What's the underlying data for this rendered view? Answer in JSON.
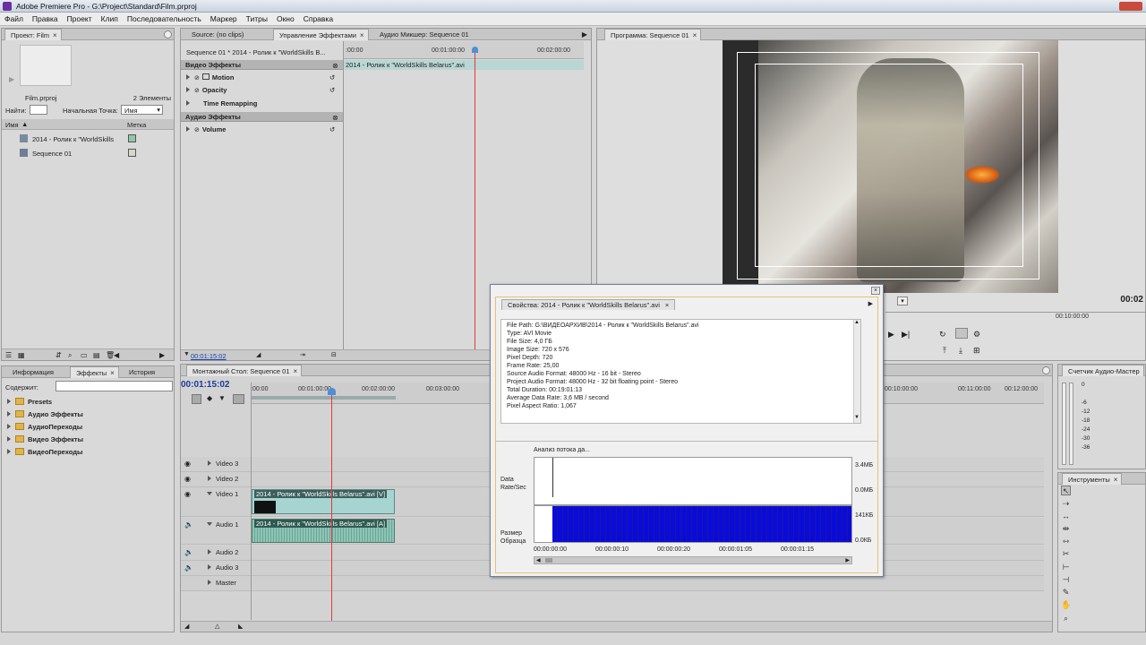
{
  "window": {
    "title": "Adobe Premiere Pro - G:\\Project\\Standard\\Film.prproj"
  },
  "menu": [
    "Файл",
    "Правка",
    "Проект",
    "Клип",
    "Последовательность",
    "Маркер",
    "Титры",
    "Окно",
    "Справка"
  ],
  "project_panel": {
    "tab": "Проект: Film",
    "file": "Film.prproj",
    "count": "2 Элементы",
    "find_label": "Найти:",
    "entry_label": "Начальная Точка:",
    "entry_value": "Имя",
    "col_name": "Имя",
    "col_label": "Метка",
    "items": [
      "2014 - Ролик к \"WorldSkills",
      "Sequence 01"
    ],
    "label_colors": [
      "#8fc7a4",
      "#d8d8c8"
    ]
  },
  "effect_controls": {
    "tabs": [
      "Source: (no clips)",
      "Управление Эффектами",
      "Аудио Микшер: Sequence 01"
    ],
    "sequence_label": "Sequence 01 * 2014 - Ролик к \"WorldSkills B...",
    "time_start": ":00:00",
    "time_mid": "00:01:00:00",
    "time_end": "00:02:00:00",
    "clip_name": "2014 - Ролик к \"WorldSkills Belarus\".avi",
    "video_header": "Видео Эффекты",
    "effects": [
      "Motion",
      "Opacity",
      "Time Remapping"
    ],
    "audio_header": "Аудио Эффекты",
    "audio_effects": [
      "Volume"
    ],
    "current_time": "00:01:15:02"
  },
  "program_monitor": {
    "tab": "Программа: Sequence 01",
    "time_right": "00:02",
    "ruler_time": "00:10:00:00"
  },
  "effects_panel": {
    "tabs": [
      "Информация",
      "Эффекты",
      "История"
    ],
    "search_label": "Содержит:",
    "folders": [
      "Presets",
      "Аудио Эффекты",
      "АудиоПереходы",
      "Видео Эффекты",
      "ВидеоПереходы"
    ]
  },
  "timeline": {
    "tab": "Монтажный Стол: Sequence 01",
    "timecode": "00:01:15:02",
    "ruler": [
      ":00:00",
      "00:01:00:00",
      "00:02:00:00",
      "00:03:00:00"
    ],
    "ruler_right": [
      "00:10:00:00",
      "00:11:00:00",
      "00:12:00:00"
    ],
    "tracks": [
      "Video 3",
      "Video 2",
      "Video 1",
      "Audio 1",
      "Audio 2",
      "Audio 3",
      "Master"
    ],
    "video_clip": "2014 - Ролик к \"WorldSkills Belarus\".avi [V]",
    "audio_clip": "2014 - Ролик к \"WorldSkills Belarus\".avi [A]"
  },
  "audio_meter": {
    "tab": "Счетчик Аудио-Мастер",
    "scale": [
      "0",
      "-6",
      "-12",
      "-18",
      "-24",
      "-30",
      "-36"
    ]
  },
  "tools_panel": {
    "tab": "Инструменты"
  },
  "properties_dialog": {
    "tab": "Свойства: 2014 - Ролик к \"WorldSkills Belarus\".avi",
    "lines": [
      "File Path: G:\\ВИДЕОАРХИВ\\2014 - Ролик к \"WorldSkills Belarus\".avi",
      "Type: AVI Movie",
      "File Size: 4,0 ГБ",
      "Image Size: 720 x 576",
      "Pixel Depth: 720",
      "Frame Rate: 25,00",
      "Source Audio Format: 48000 Hz - 16 bit - Stereo",
      "Project Audio Format: 48000 Hz - 32 bit floating point - Stereo",
      "Total Duration: 00:19:01:13",
      "Average Data Rate: 3,6 MB / second",
      "Pixel Aspect Ratio: 1,067"
    ],
    "analysis": "Анализ потока да...",
    "rate_label": "Data Rate/Sec",
    "sample_label": "Размер Образца",
    "rate_scale": [
      "3.4МБ",
      "0.0МБ"
    ],
    "sample_scale": [
      "141КБ",
      "0.0КБ"
    ],
    "time_ticks": [
      "00:00:00:00",
      "00:00:00:10",
      "00:00:00:20",
      "00:00:01:05",
      "00:00:01:15"
    ],
    "bar_color": "#0b0bd8"
  }
}
